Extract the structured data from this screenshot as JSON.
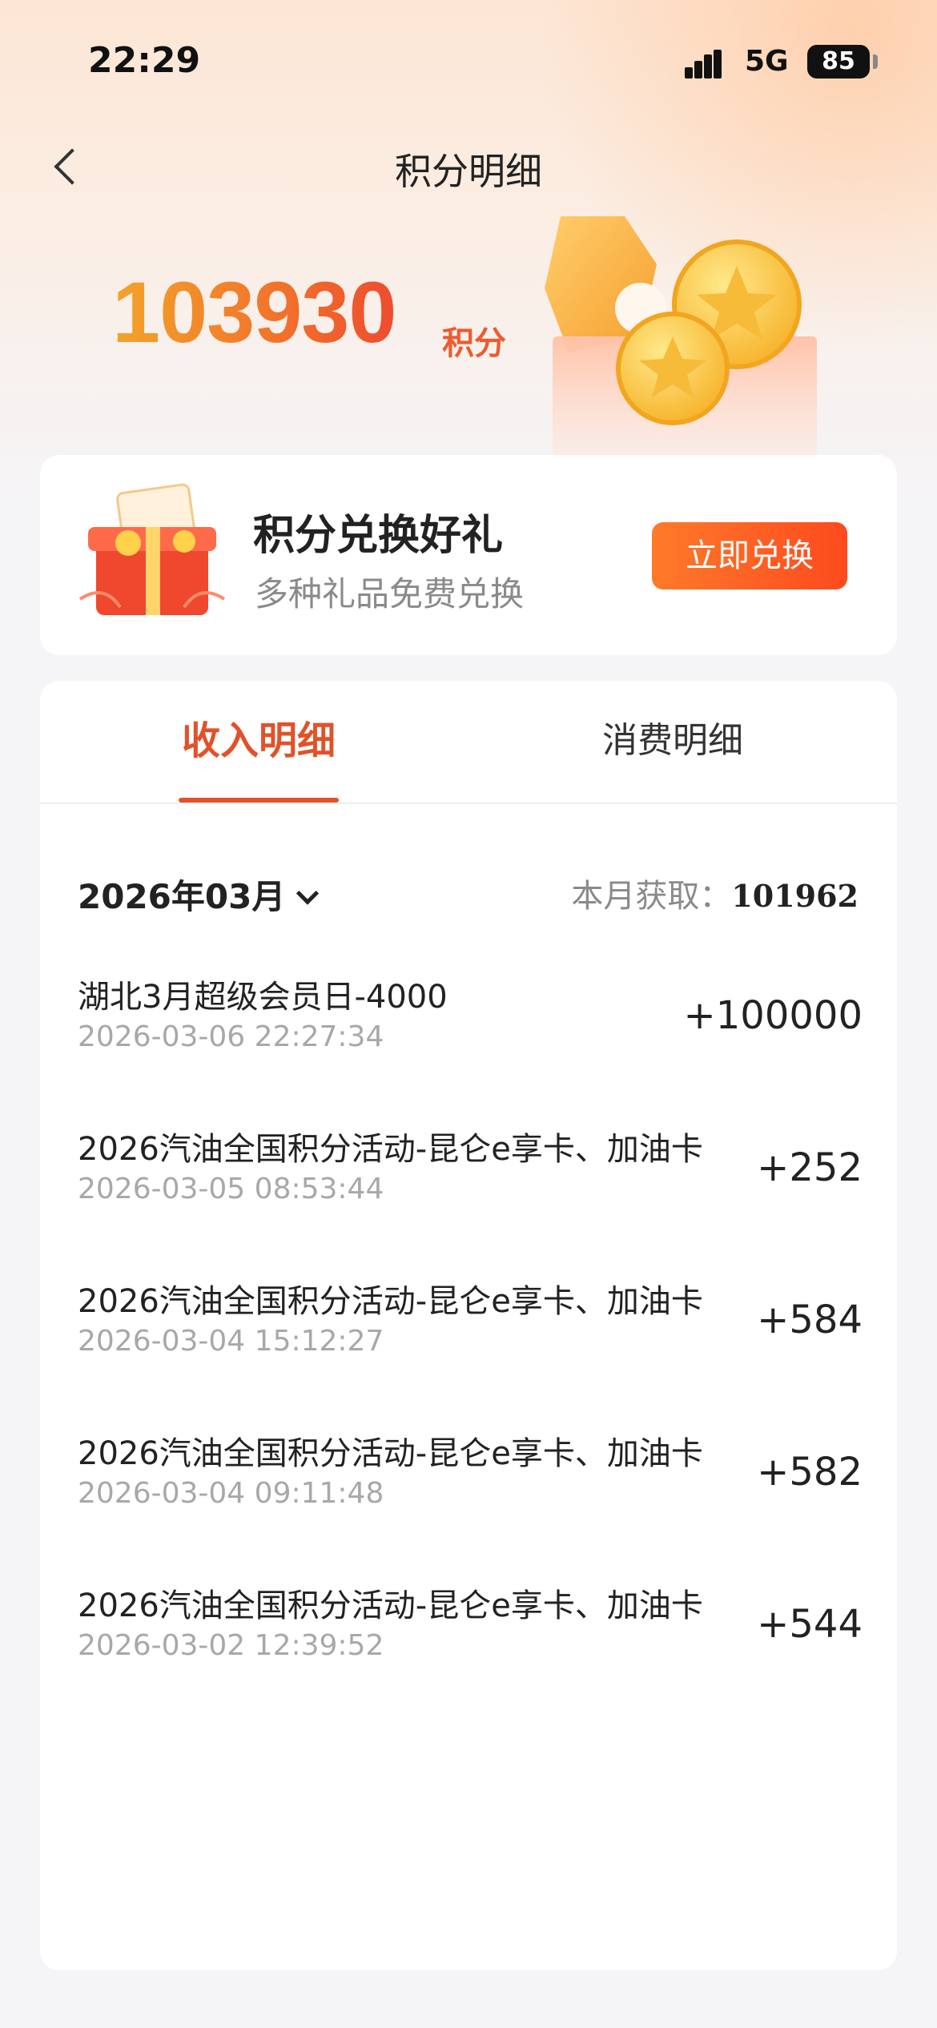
{
  "status_bar": {
    "time": "22:29",
    "network": "5G",
    "battery": "85"
  },
  "nav": {
    "title": "积分明细"
  },
  "points": {
    "value": "103930",
    "unit": "积分"
  },
  "promo": {
    "title": "积分兑换好礼",
    "subtitle": "多种礼品免费兑换",
    "button_label": "立即兑换"
  },
  "tabs": [
    {
      "label": "收入明细",
      "active": true
    },
    {
      "label": "消费明细",
      "active": false
    }
  ],
  "filter": {
    "month": "2026年03月",
    "summary_label": "本月获取：",
    "summary_value": "101962"
  },
  "records": [
    {
      "title": "湖北3月超级会员日-4000",
      "time": "2026-03-06 22:27:34",
      "amount": "+100000"
    },
    {
      "title": "2026汽油全国积分活动-昆仑e享卡、加油卡",
      "time": "2026-03-05 08:53:44",
      "amount": "+252"
    },
    {
      "title": "2026汽油全国积分活动-昆仑e享卡、加油卡",
      "time": "2026-03-04 15:12:27",
      "amount": "+584"
    },
    {
      "title": "2026汽油全国积分活动-昆仑e享卡、加油卡",
      "time": "2026-03-04 09:11:48",
      "amount": "+582"
    },
    {
      "title": "2026汽油全国积分活动-昆仑e享卡、加油卡",
      "time": "2026-03-02 12:39:52",
      "amount": "+544"
    }
  ],
  "colors": {
    "accent": "#e1522a",
    "button_start": "#ff7a2a",
    "button_end": "#fd4a1e",
    "points_gradient": [
      "#f3a42a",
      "#ee4c2f"
    ]
  }
}
